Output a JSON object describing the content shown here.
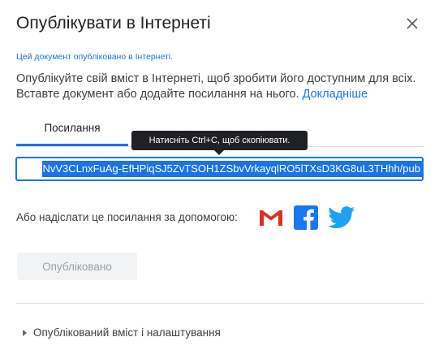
{
  "dialog": {
    "title": "Опублікувати в Інтернеті",
    "close_icon": "close-icon",
    "notice": "Цей документ опубліковано в Інтернеті.",
    "description": "Опублікуйте свій вміст в Інтернеті, щоб зробити його доступним для всіх. Вставте документ або додайте посилання на нього.",
    "learn_more": "Докладніше"
  },
  "tabs": [
    {
      "label": "Посилання",
      "active": true
    }
  ],
  "tooltip": "Натисніть Ctrl+C, щоб скопіювати.",
  "link": {
    "value": "NvV3CLnxFuAg-EfHPiqSJ5ZvTSOH1ZSbvVrkayqlRO5lTXsD3KG8uL3THhh/pub"
  },
  "share": {
    "label": "Або надіслати це посилання за допомогою:",
    "services": [
      "gmail-icon",
      "facebook-icon",
      "twitter-icon"
    ],
    "colors": {
      "gmail": "#d93025",
      "facebook": "#1877f2",
      "twitter": "#1da1f2"
    }
  },
  "publish_button": {
    "label": "Опубліковано",
    "disabled": true
  },
  "settings": {
    "label": "Опублікований вміст і налаштування",
    "icon": "caret-right-icon"
  },
  "colors": {
    "accent": "#1a73e8",
    "tooltip": "#202124"
  }
}
